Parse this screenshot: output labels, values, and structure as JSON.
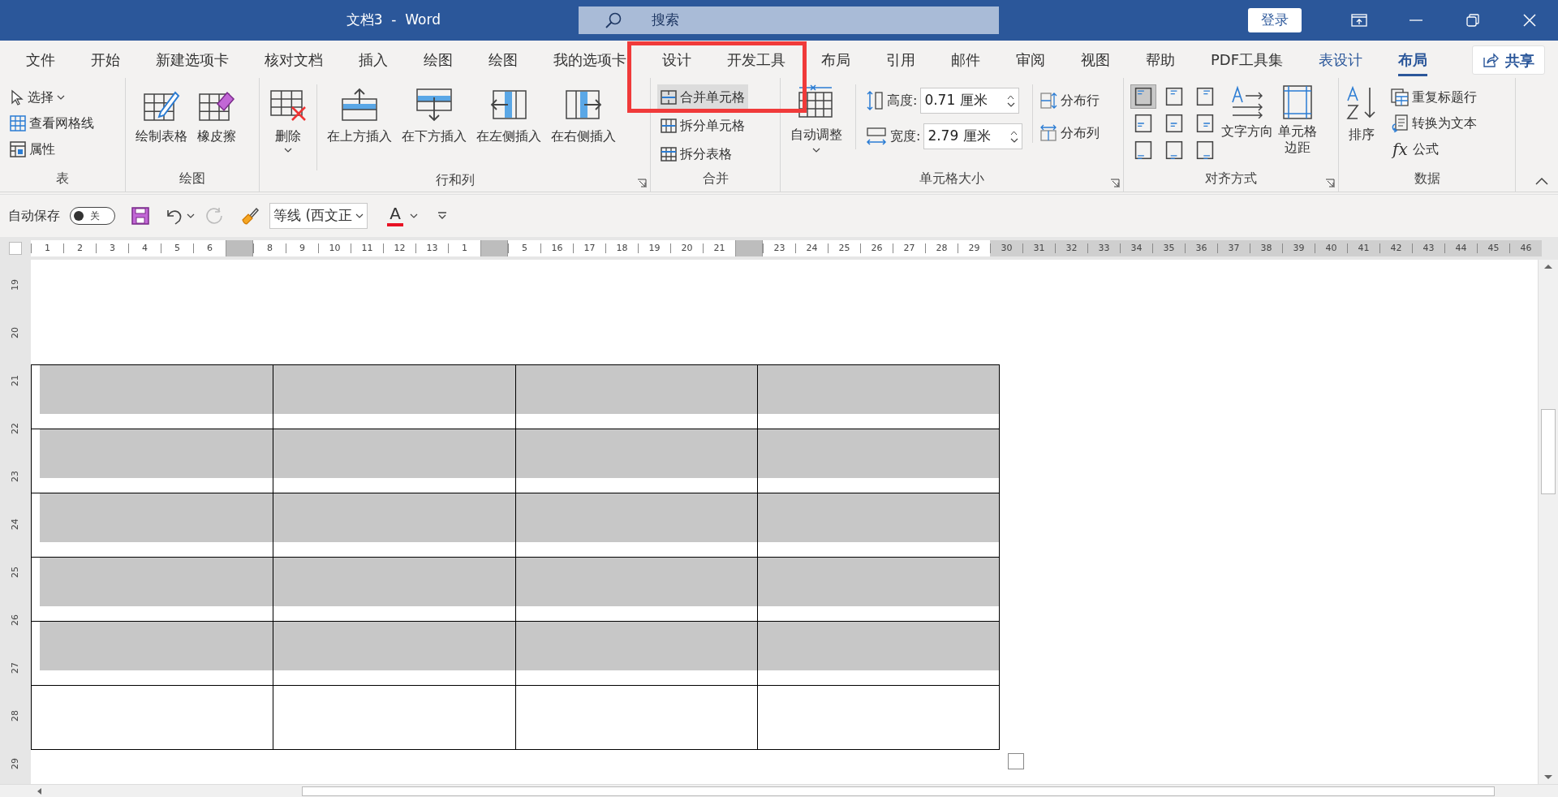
{
  "title_bar": {
    "title": "文档3  -  Word",
    "search_placeholder": "搜索",
    "login": "登录"
  },
  "tabs": [
    {
      "label": "文件",
      "selected": false,
      "kind": "normal"
    },
    {
      "label": "开始",
      "selected": false,
      "kind": "normal"
    },
    {
      "label": "新建选项卡",
      "selected": false,
      "kind": "normal"
    },
    {
      "label": "核对文档",
      "selected": false,
      "kind": "normal"
    },
    {
      "label": "插入",
      "selected": false,
      "kind": "normal"
    },
    {
      "label": "绘图",
      "selected": false,
      "kind": "normal"
    },
    {
      "label": "绘图",
      "selected": false,
      "kind": "normal"
    },
    {
      "label": "我的选项卡",
      "selected": false,
      "kind": "normal"
    },
    {
      "label": "设计",
      "selected": false,
      "kind": "normal"
    },
    {
      "label": "开发工具",
      "selected": false,
      "kind": "normal"
    },
    {
      "label": "布局",
      "selected": false,
      "kind": "normal"
    },
    {
      "label": "引用",
      "selected": false,
      "kind": "normal"
    },
    {
      "label": "邮件",
      "selected": false,
      "kind": "normal"
    },
    {
      "label": "审阅",
      "selected": false,
      "kind": "normal"
    },
    {
      "label": "视图",
      "selected": false,
      "kind": "normal"
    },
    {
      "label": "帮助",
      "selected": false,
      "kind": "normal"
    },
    {
      "label": "PDF工具集",
      "selected": false,
      "kind": "normal"
    },
    {
      "label": "表设计",
      "selected": false,
      "kind": "context"
    },
    {
      "label": "布局",
      "selected": true,
      "kind": "context"
    }
  ],
  "share": "共享",
  "ribbon": {
    "table": {
      "label": "表",
      "items": [
        {
          "kind": "cursor",
          "label": "选择",
          "dropdown": true
        },
        {
          "kind": "grid",
          "label": "查看网格线",
          "dropdown": false
        },
        {
          "kind": "properties",
          "label": "属性",
          "dropdown": false
        }
      ]
    },
    "draw": {
      "label": "绘图",
      "items": [
        {
          "kind": "draw-table",
          "label": "绘制表格"
        },
        {
          "kind": "eraser",
          "label": "橡皮擦"
        }
      ]
    },
    "rows_cols": {
      "label": "行和列",
      "delete": {
        "kind": "delete-table",
        "label": "删除"
      },
      "items": [
        {
          "kind": "insert-above",
          "label": "在上方插入"
        },
        {
          "kind": "insert-below",
          "label": "在下方插入"
        },
        {
          "kind": "insert-left",
          "label": "在左侧插入"
        },
        {
          "kind": "insert-right",
          "label": "在右侧插入"
        }
      ]
    },
    "merge": {
      "label": "合并",
      "items": [
        {
          "kind": "merge",
          "label": "合并单元格",
          "selected": true
        },
        {
          "kind": "split-cells",
          "label": "拆分单元格",
          "selected": false
        },
        {
          "kind": "split-table",
          "label": "拆分表格",
          "selected": false
        }
      ]
    },
    "cell_size": {
      "label": "单元格大小",
      "autofit": "自动调整",
      "height": {
        "label": "高度:",
        "value": "0.71 厘米"
      },
      "width": {
        "label": "宽度:",
        "value": "2.79 厘米"
      },
      "distribute_rows": "分布行",
      "distribute_cols": "分布列"
    },
    "alignment": {
      "label": "对齐方式",
      "buttons": [
        {
          "selected": true
        },
        {
          "selected": false
        },
        {
          "selected": false
        },
        {
          "selected": false
        },
        {
          "selected": false
        },
        {
          "selected": false
        },
        {
          "selected": false
        },
        {
          "selected": false
        },
        {
          "selected": false
        }
      ],
      "text_direction": "文字方向",
      "cell_margins": "单元格边距"
    },
    "data": {
      "label": "数据",
      "sort": "排序",
      "items": [
        {
          "kind": "repeat-header",
          "label": "重复标题行"
        },
        {
          "kind": "convert-text",
          "label": "转换为文本"
        },
        {
          "kind": "formula",
          "label": "公式",
          "glyph": "fx"
        }
      ]
    }
  },
  "qat": {
    "autosave_label": "自动保存",
    "autosave": {
      "on": false,
      "text": "关"
    },
    "font": "等线 (西文正",
    "font_color_glyph": "A"
  },
  "ruler": [
    {
      "kind": "page",
      "ticks": [
        "1",
        "2",
        "3",
        "4",
        "5",
        "6"
      ]
    },
    {
      "kind": "marker"
    },
    {
      "kind": "page",
      "ticks": [
        "8",
        "9",
        "10",
        "11",
        "12",
        "13",
        "1"
      ]
    },
    {
      "kind": "marker"
    },
    {
      "kind": "page",
      "ticks": [
        "5",
        "16",
        "17",
        "18",
        "19",
        "20",
        "21"
      ]
    },
    {
      "kind": "marker"
    },
    {
      "kind": "page",
      "ticks": [
        "23",
        "24",
        "25",
        "26",
        "27",
        "28",
        "29"
      ]
    },
    {
      "kind": "margin",
      "ticks": [
        "30",
        "31",
        "32",
        "33",
        "34",
        "35",
        "36",
        "37",
        "38",
        "39",
        "40",
        "41",
        "42",
        "43",
        "44",
        "45",
        "46"
      ]
    }
  ],
  "vertical_ruler": [
    "19",
    "20",
    "21",
    "22",
    "23",
    "24",
    "25",
    "26",
    "27",
    "28",
    "29"
  ],
  "table": {
    "rows": [
      {
        "cells": [
          {
            "shaded": true
          },
          {
            "shaded": true
          },
          {
            "shaded": true
          },
          {
            "shaded": true
          }
        ]
      },
      {
        "cells": [
          {
            "shaded": true
          },
          {
            "shaded": true
          },
          {
            "shaded": true
          },
          {
            "shaded": true
          }
        ]
      },
      {
        "cells": [
          {
            "shaded": true
          },
          {
            "shaded": true
          },
          {
            "shaded": true
          },
          {
            "shaded": true
          }
        ]
      },
      {
        "cells": [
          {
            "shaded": true
          },
          {
            "shaded": true
          },
          {
            "shaded": true
          },
          {
            "shaded": true
          }
        ]
      },
      {
        "cells": [
          {
            "shaded": true
          },
          {
            "shaded": true
          },
          {
            "shaded": true
          },
          {
            "shaded": true
          }
        ]
      },
      {
        "cells": [
          {
            "shaded": false
          },
          {
            "shaded": false
          },
          {
            "shaded": false
          },
          {
            "shaded": false
          }
        ]
      }
    ]
  }
}
